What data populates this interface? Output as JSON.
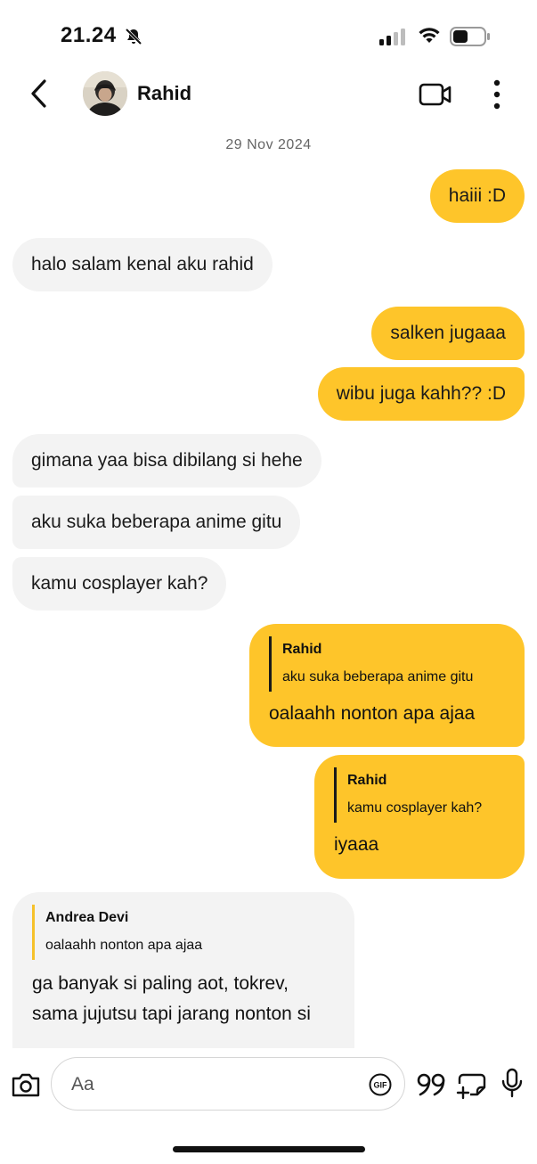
{
  "status_bar": {
    "time": "21.24",
    "icons": [
      "bell-slash-icon",
      "cellular-signal-icon",
      "wifi-icon",
      "battery-icon"
    ]
  },
  "header": {
    "contact_name": "Rahid",
    "icons": [
      "back-chevron-icon",
      "video-call-icon",
      "more-vertical-icon"
    ]
  },
  "chat": {
    "date": "29 Nov 2024",
    "messages": [
      {
        "direction": "out",
        "text": "haiii :D"
      },
      {
        "direction": "in",
        "text": "halo salam kenal aku rahid"
      },
      {
        "direction": "out",
        "text": "salken jugaaa"
      },
      {
        "direction": "out",
        "text": "wibu juga kahh?? :D"
      },
      {
        "direction": "in",
        "text": "gimana yaa bisa dibilang si hehe"
      },
      {
        "direction": "in",
        "text": "aku suka beberapa anime gitu"
      },
      {
        "direction": "in",
        "text": "kamu cosplayer kah?"
      },
      {
        "direction": "out",
        "reply_to": {
          "author": "Rahid",
          "text": "aku suka beberapa anime gitu"
        },
        "text": "oalaahh nonton apa ajaa"
      },
      {
        "direction": "out",
        "reply_to": {
          "author": "Rahid",
          "text": "kamu cosplayer kah?"
        },
        "text": "iyaaa"
      },
      {
        "direction": "in",
        "reply_to": {
          "author": "Andrea Devi",
          "text": "oalaahh nonton apa ajaa"
        },
        "text": "ga banyak si paling aot, tokrev, sama jujutsu tapi jarang nonton si"
      }
    ]
  },
  "composer": {
    "placeholder": "Aa",
    "value": "",
    "gif_label": "GIF"
  },
  "colors": {
    "outgoing_bubble": "#fec52a",
    "incoming_bubble": "#f3f3f3",
    "text": "#111111"
  }
}
